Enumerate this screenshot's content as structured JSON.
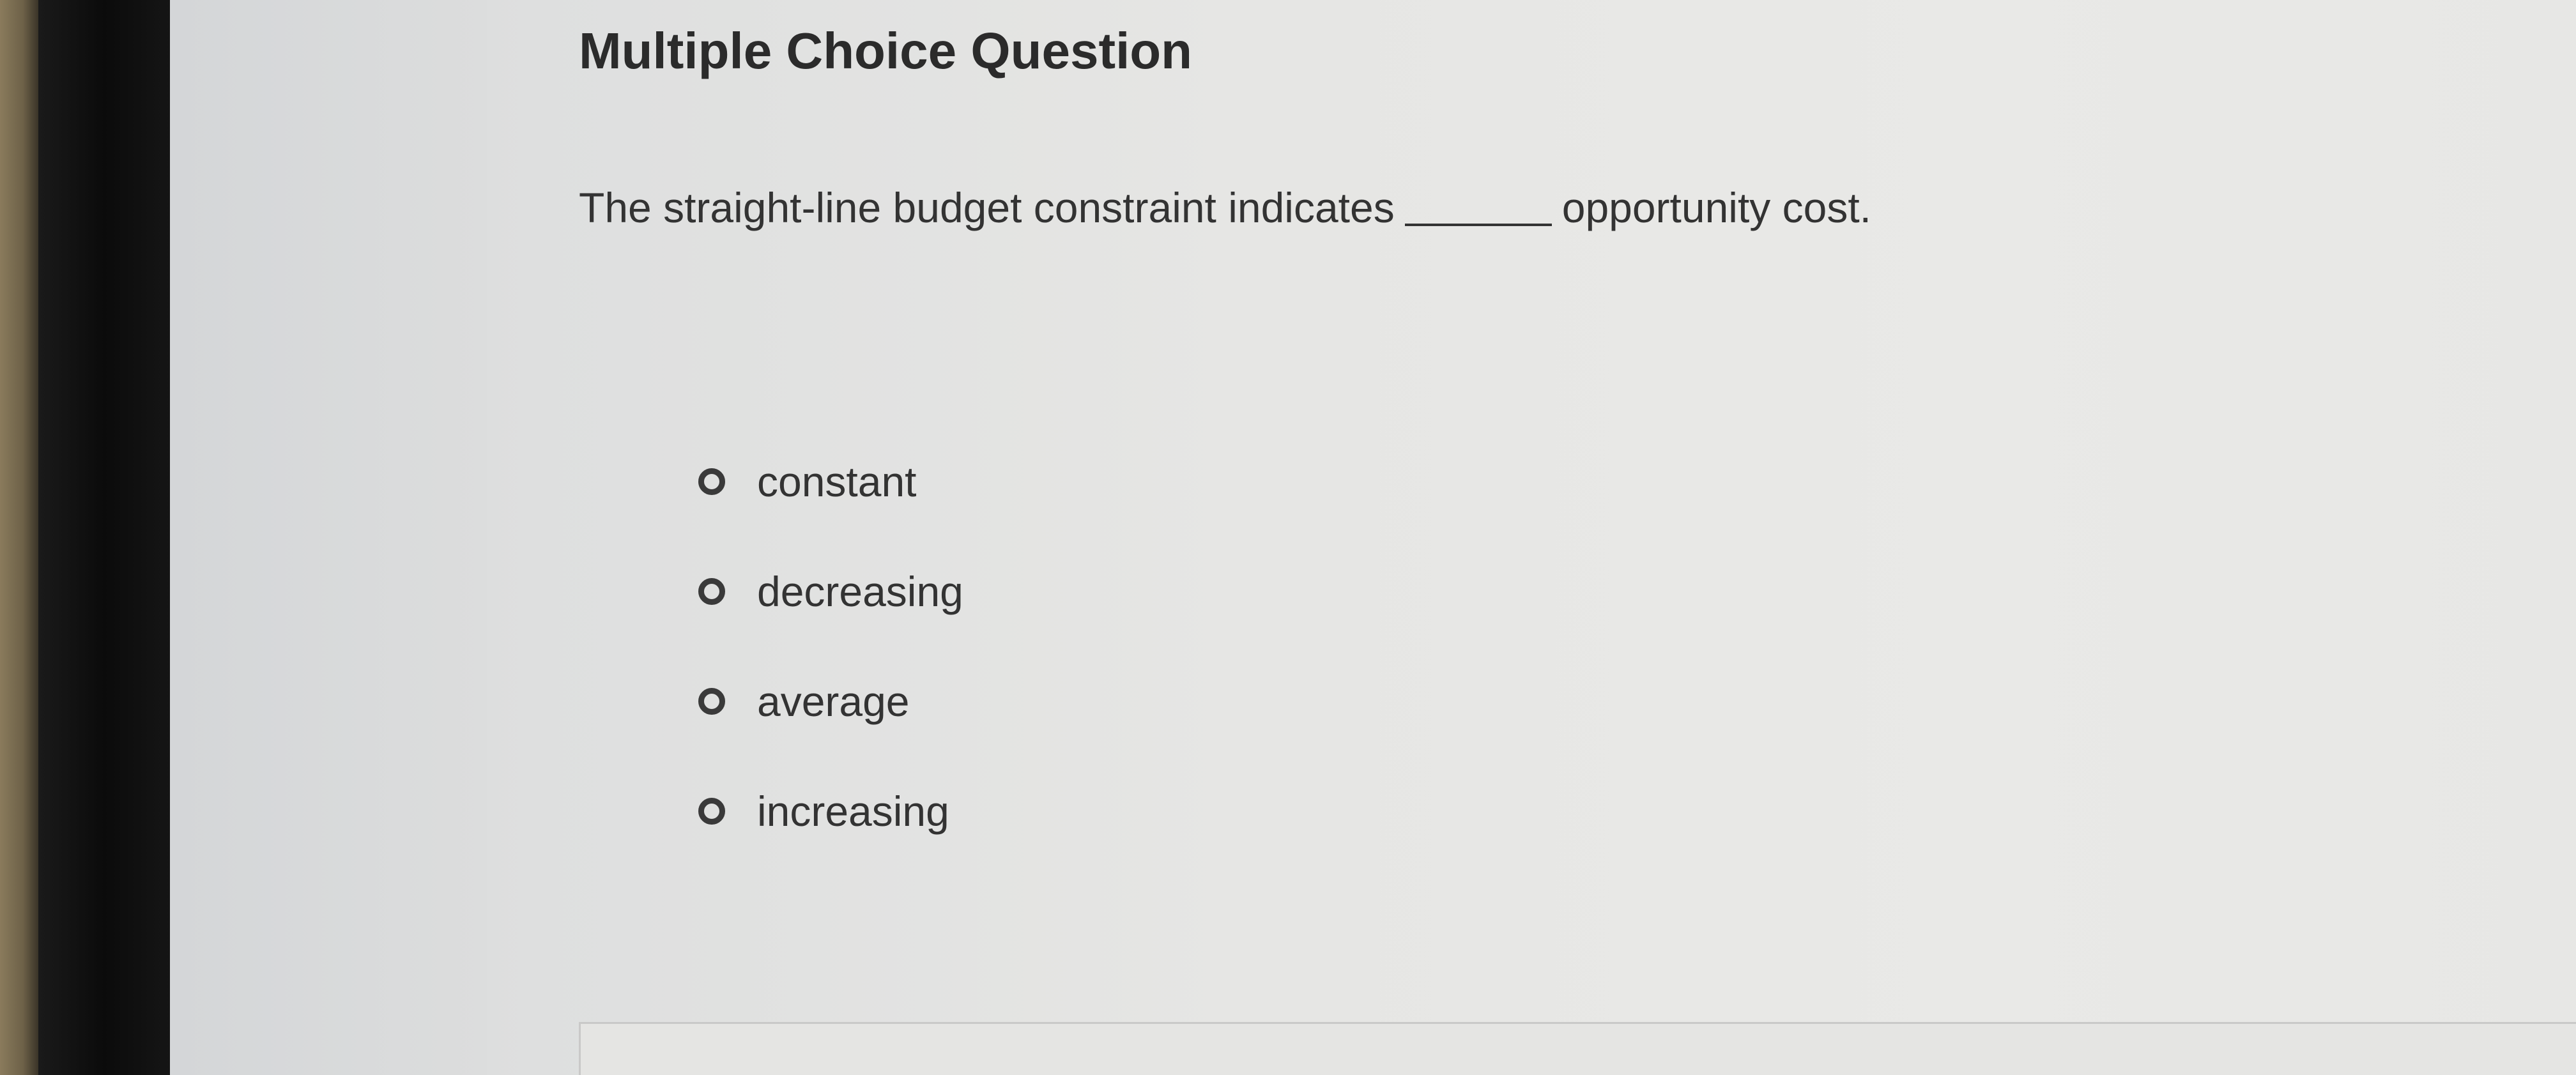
{
  "question": {
    "title": "Multiple Choice Question",
    "prompt_before": "The straight-line budget constraint indicates",
    "prompt_after": "opportunity cost.",
    "options": [
      {
        "label": "constant"
      },
      {
        "label": "decreasing"
      },
      {
        "label": "average"
      },
      {
        "label": "increasing"
      }
    ]
  }
}
